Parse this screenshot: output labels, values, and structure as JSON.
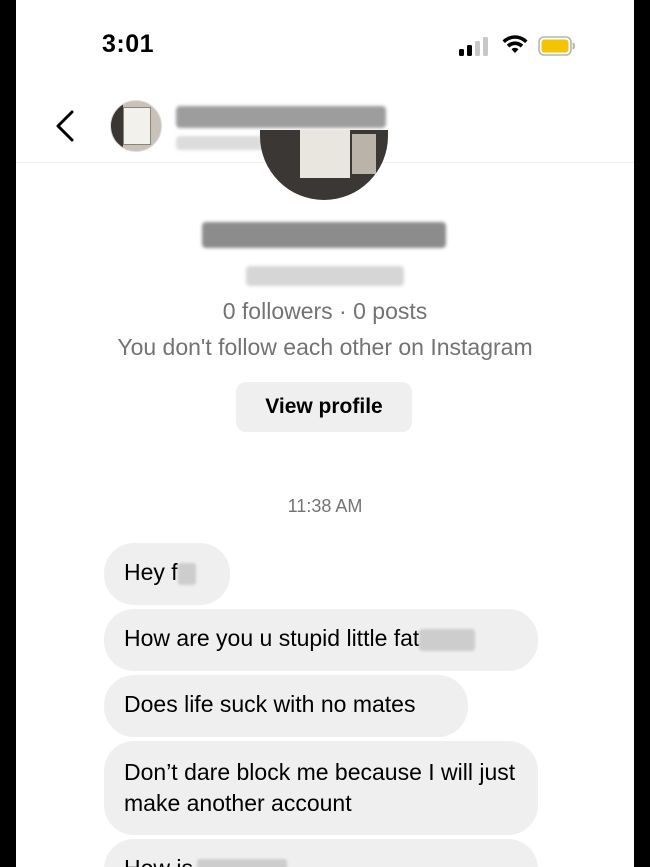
{
  "status_bar": {
    "time": "3:01"
  },
  "colors": {
    "battery": "#f5c400",
    "bubble": "#efefef",
    "muted_text": "#737373"
  },
  "header": {
    "back_icon": "chevron-left-icon"
  },
  "profile": {
    "stats": "0 followers · 0 posts",
    "mutual": "You don't follow each other on Instagram",
    "view_profile_label": "View profile"
  },
  "thread": {
    "timestamp": "11:38 AM",
    "messages": [
      {
        "text": "Hey f"
      },
      {
        "text": "How are you u stupid little fat"
      },
      {
        "text": "Does life suck with no mates"
      },
      {
        "text": "Don’t dare block me because I will just make another account"
      },
      {
        "text": "How is"
      }
    ]
  }
}
